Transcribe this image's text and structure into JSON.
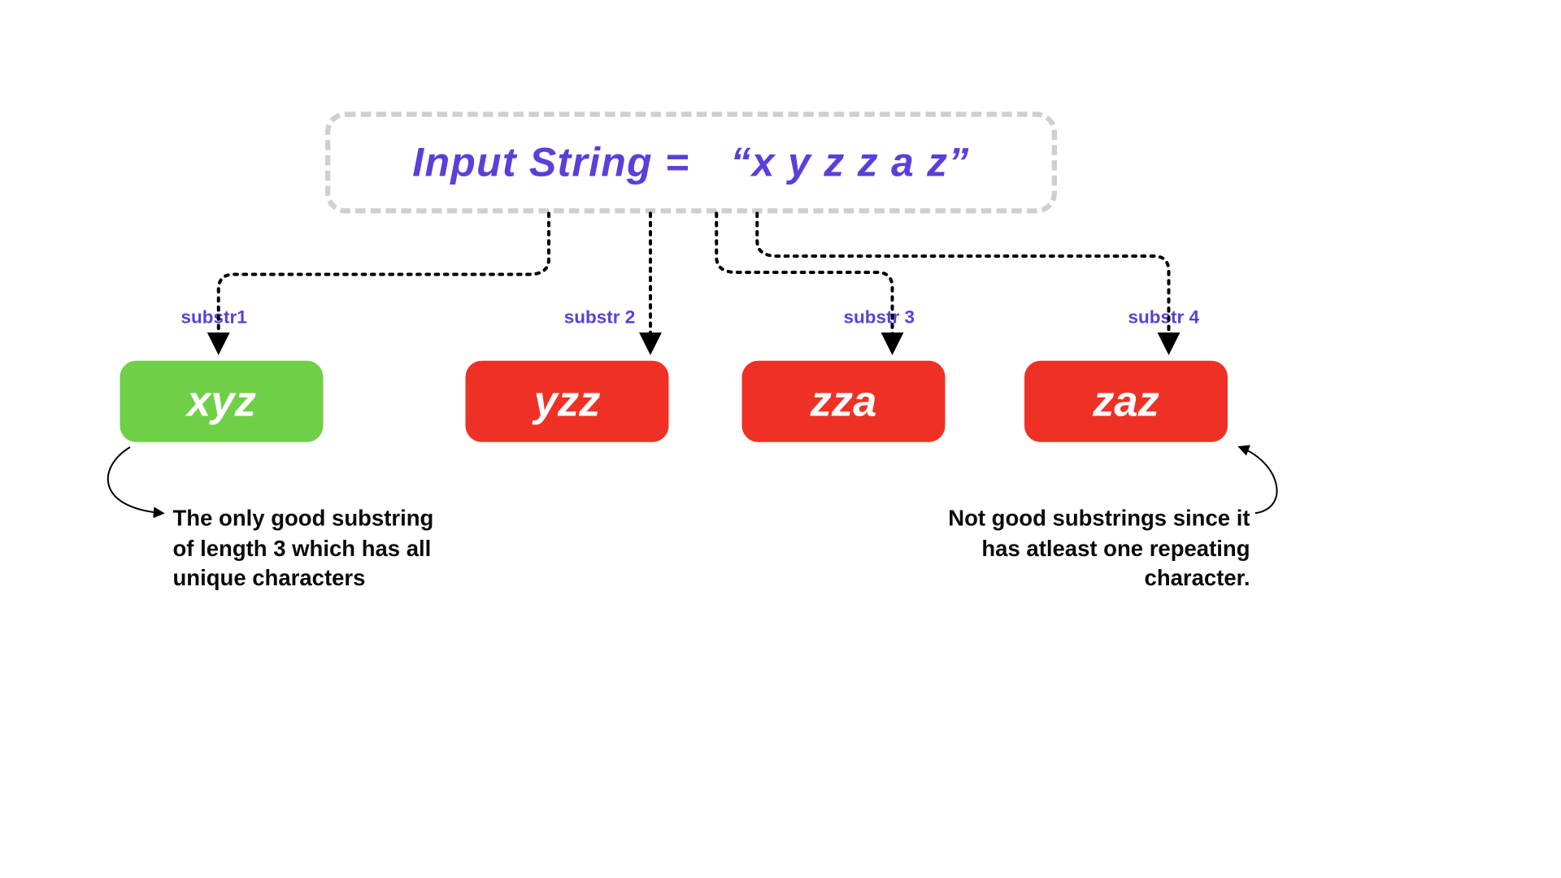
{
  "input": {
    "label": "Input String =",
    "value": "“x y z z a z”"
  },
  "sub_labels": {
    "s1": "substr1",
    "s2": "substr 2",
    "s3": "substr 3",
    "s4": "substr 4"
  },
  "cards": {
    "c1": "xyz",
    "c2": "yzz",
    "c3": "zza",
    "c4": "zaz"
  },
  "colors": {
    "good": "#6fcf46",
    "bad": "#ef3125",
    "accent": "#5b3fd8",
    "border": "#cfcfcf"
  },
  "notes": {
    "left": "The only good substring of length 3 which has all unique characters",
    "right": "Not good substrings since it has atleast one repeating character."
  }
}
